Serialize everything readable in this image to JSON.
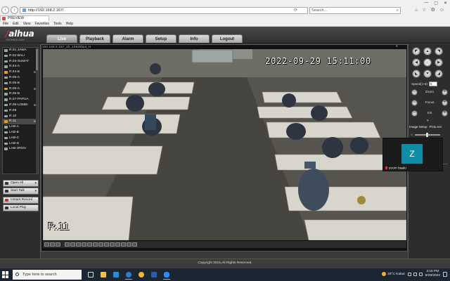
{
  "browser": {
    "url": "http://192.168.2.167/",
    "search_placeholder": "Search...",
    "tab_title": "PREVIEW",
    "menu": [
      "File",
      "Edit",
      "View",
      "Favorites",
      "Tools",
      "Help"
    ]
  },
  "app": {
    "logo": "alhua",
    "logo_sub": "TECHNOLOGY",
    "tabs": [
      {
        "label": "Live",
        "active": true
      },
      {
        "label": "Playback",
        "active": false
      },
      {
        "label": "Alarm",
        "active": false
      },
      {
        "label": "Setup",
        "active": false
      },
      {
        "label": "Info",
        "active": false
      },
      {
        "label": "Logout",
        "active": false
      }
    ]
  },
  "channels": [
    {
      "label": "R.01-JAWA",
      "on": false,
      "mark": ""
    },
    {
      "label": "R.02-BALI",
      "on": false,
      "mark": ""
    },
    {
      "label": "R.03-SUMAT",
      "on": false,
      "mark": ""
    },
    {
      "label": "R.04-A",
      "on": false,
      "mark": ""
    },
    {
      "label": "R.04-B",
      "on": true,
      "mark": "M"
    },
    {
      "label": "R.05-A",
      "on": false,
      "mark": ""
    },
    {
      "label": "R.05-B",
      "on": false,
      "mark": ""
    },
    {
      "label": "R.06-A",
      "on": true,
      "mark": "M"
    },
    {
      "label": "R.06-B",
      "on": false,
      "mark": ""
    },
    {
      "label": "R.07-PAPUA",
      "on": false,
      "mark": ""
    },
    {
      "label": "R.08-LOMBI",
      "on": false,
      "mark": "M"
    },
    {
      "label": "R.09",
      "on": false,
      "mark": ""
    },
    {
      "label": "R.10",
      "on": false,
      "mark": ""
    },
    {
      "label": "R.11",
      "on": true,
      "mark": "M"
    },
    {
      "label": "LAB-A",
      "on": false,
      "mark": ""
    },
    {
      "label": "LAB-B",
      "on": false,
      "mark": ""
    },
    {
      "label": "LAB-C",
      "on": false,
      "mark": ""
    },
    {
      "label": "LAB-D",
      "on": false,
      "mark": ""
    },
    {
      "label": "LAB-JRGN",
      "on": false,
      "mark": ""
    }
  ],
  "controls": {
    "open_all": "Open All",
    "start_talk": "Start Talk",
    "instant_record": "Instant Record",
    "local_play": "Local Play"
  },
  "video": {
    "info": "192.168.2.167_1h_1052kbps_H",
    "close": "x",
    "timestamp": "2022-09-29 15:11:00",
    "camera_label": "R.11"
  },
  "ptz": {
    "speed_label": "Speed(1-8)",
    "speed_value": "5",
    "zoom_label": "Zoom",
    "focus_label": "Focus",
    "iris_label": "Iris",
    "image_setup": "Image Setup",
    "ptz_setup": "Pictu ext"
  },
  "zoom_meeting": {
    "initial": "Z",
    "name": "zoom baalo"
  },
  "footer": {
    "copyright": "Copyright 2015,All Rights Reserved."
  },
  "taskbar": {
    "search_placeholder": "Type here to search",
    "weather": "33°C  Kabut",
    "time": "3:15 PM",
    "date": "9/29/2022",
    "colors": {
      "edge": "#2f7ad6",
      "chrome": "#f2b632",
      "explorer": "#f5c344",
      "mail": "#2a8bd6",
      "word": "#2b5ca8",
      "zoom": "#2d8cff"
    }
  }
}
